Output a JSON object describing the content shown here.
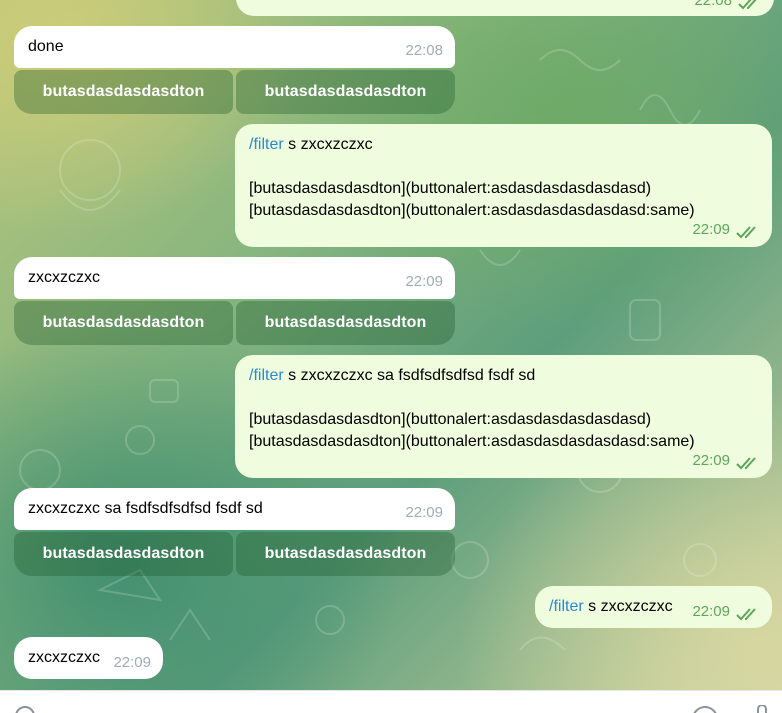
{
  "messages": [
    {
      "id": "m0",
      "direction": "out",
      "text": "",
      "time": "22:08",
      "read": true
    },
    {
      "id": "m1",
      "direction": "in",
      "text": "done",
      "time": "22:08",
      "buttons": [
        "butasdasdasdasdton",
        "butasdasdasdasdton"
      ]
    },
    {
      "id": "m2",
      "direction": "out",
      "command": "/filter",
      "text": " s zxcxzczxc\n\n[butasdasdasdasdton](buttonalert:asdasdasdasdasdasd)\n[butasdasdasdasdton](buttonalert:asdasdasdasdasdasd:same)",
      "time": "22:09",
      "read": true
    },
    {
      "id": "m3",
      "direction": "in",
      "text": "zxcxzczxc",
      "time": "22:09",
      "buttons": [
        "butasdasdasdasdton",
        "butasdasdasdasdton"
      ]
    },
    {
      "id": "m4",
      "direction": "out",
      "command": "/filter",
      "text": " s zxcxzczxc sa fsdfsdfsdfsd fsdf sd\n\n[butasdasdasdasdton](buttonalert:asdasdasdasdasdasd)\n[butasdasdasdasdton](buttonalert:asdasdasdasdasdasd:same)",
      "time": "22:09",
      "read": true
    },
    {
      "id": "m5",
      "direction": "in",
      "text": "zxcxzczxc sa fsdfsdfsdfsd fsdf sd",
      "time": "22:09",
      "buttons": [
        "butasdasdasdasdton",
        "butasdasdasdasdton"
      ]
    },
    {
      "id": "m6",
      "direction": "out",
      "command": "/filter",
      "text": " s zxcxzczxc",
      "time": "22:09",
      "read": true
    },
    {
      "id": "m7",
      "direction": "in",
      "text": "zxcxzczxc",
      "time": "22:09"
    }
  ],
  "icons": {
    "read_receipt": "double-check-icon",
    "attach": "paperclip-icon",
    "emoji": "smile-icon",
    "voice": "microphone-icon"
  },
  "colors": {
    "incoming_bubble": "#ffffff",
    "outgoing_bubble": "#effdde",
    "command_link": "#2a8ad2",
    "outgoing_time": "#5ea65b",
    "incoming_time": "#a0acb6",
    "inline_button": "#5a8a58"
  }
}
